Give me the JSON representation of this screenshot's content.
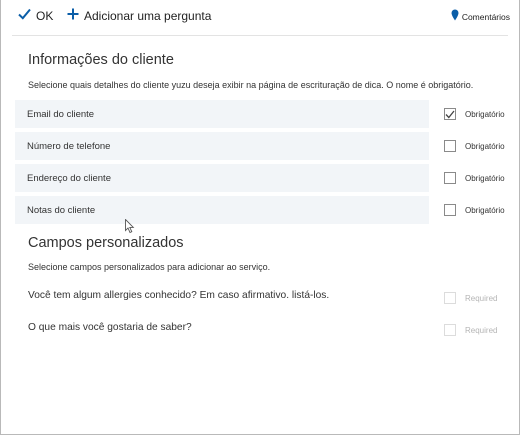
{
  "toolbar": {
    "ok_label": "OK",
    "add_question_label": "Adicionar uma pergunta",
    "feedback_label": "Comentários",
    "accent_color": "#0b5ea8"
  },
  "customer_info": {
    "title": "Informações do cliente",
    "description": "Selecione quais detalhes do cliente yuzu deseja exibir na página de escrituração de dica. O nome é obrigatório.",
    "fields": [
      {
        "label": "Email do cliente",
        "required_label": "Obrigatório",
        "required_checked": true
      },
      {
        "label": "Número de telefone",
        "required_label": "Obrigatório",
        "required_checked": false
      },
      {
        "label": "Endereço do cliente",
        "required_label": "Obrigatório",
        "required_checked": false
      },
      {
        "label": "Notas do cliente",
        "required_label": "Obrigatório",
        "required_checked": false
      }
    ]
  },
  "custom_fields": {
    "title": "Campos personalizados",
    "description": "Selecione campos personalizados para adicionar ao serviço.",
    "questions": [
      {
        "text": "Você tem algum allergies conhecido? Em caso afirmativo. listá-los.",
        "required_label": "Required",
        "enabled": false
      },
      {
        "text": "O que mais você gostaria de saber?",
        "required_label": "Required",
        "enabled": false
      }
    ]
  }
}
